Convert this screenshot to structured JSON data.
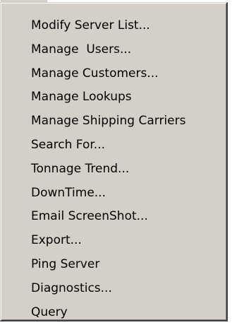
{
  "menu": {
    "items": [
      {
        "label": "Modify Server List..."
      },
      {
        "label": "Manage  Users..."
      },
      {
        "label": "Manage Customers..."
      },
      {
        "label": "Manage Lookups"
      },
      {
        "label": "Manage Shipping Carriers"
      },
      {
        "label": "Search For..."
      },
      {
        "label": "Tonnage Trend..."
      },
      {
        "label": "DownTime..."
      },
      {
        "label": "Email ScreenShot..."
      },
      {
        "label": "Export..."
      },
      {
        "label": "Ping Server"
      },
      {
        "label": "Diagnostics..."
      },
      {
        "label": "Query"
      }
    ]
  }
}
